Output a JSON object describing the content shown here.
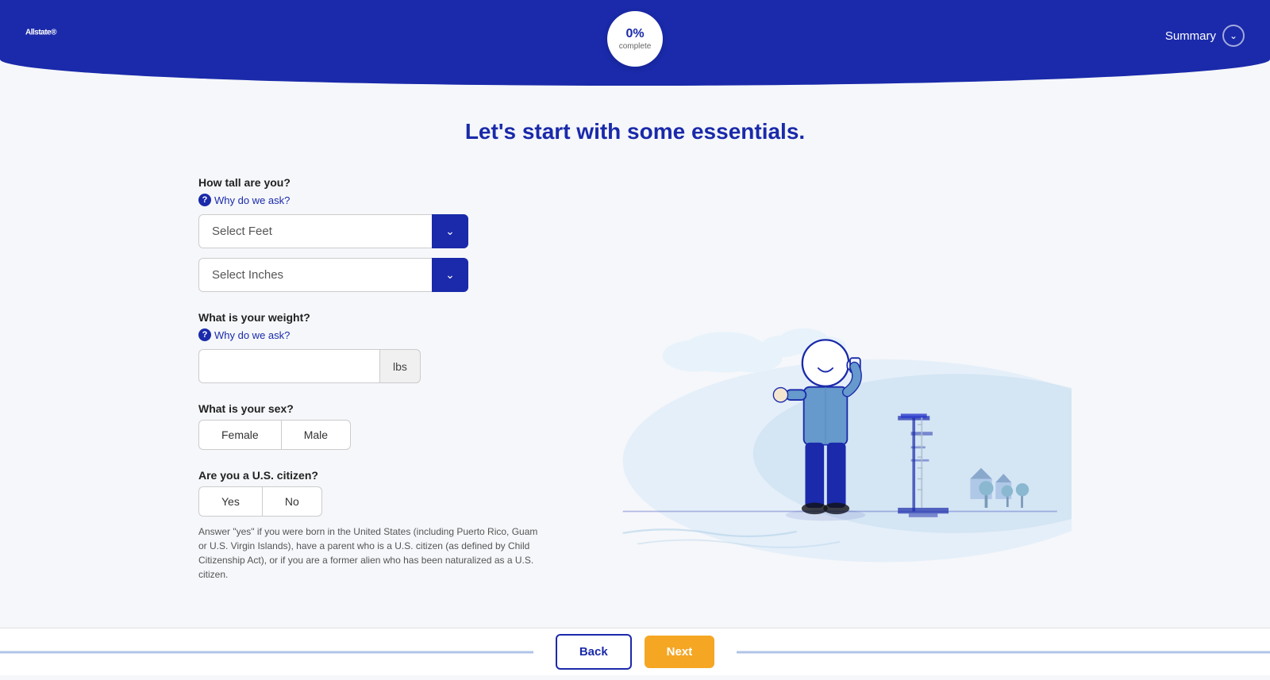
{
  "header": {
    "logo": "Allstate",
    "logo_tm": "®",
    "progress": {
      "percentage": "0%",
      "label": "complete"
    },
    "summary_button": "Summary"
  },
  "main": {
    "title": "Let's start with some essentials.",
    "fields": {
      "height": {
        "label": "How tall are you?",
        "why_ask": "Why do we ask?",
        "feet_placeholder": "Select Feet",
        "inches_placeholder": "Select Inches"
      },
      "weight": {
        "label": "What is your weight?",
        "why_ask": "Why do we ask?",
        "unit": "lbs",
        "placeholder": ""
      },
      "sex": {
        "label": "What is your sex?",
        "options": [
          "Female",
          "Male"
        ]
      },
      "citizenship": {
        "label": "Are you a U.S. citizen?",
        "options": [
          "Yes",
          "No"
        ],
        "note": "Answer \"yes\" if you were born in the United States (including Puerto Rico, Guam or U.S. Virgin Islands), have a parent who is a U.S. citizen (as defined by Child Citizenship Act), or if you are a former alien who has been naturalized as a U.S. citizen."
      }
    }
  },
  "footer": {
    "back_label": "Back",
    "next_label": "Next"
  },
  "colors": {
    "primary": "#1a2aaa",
    "accent": "#f5a623",
    "light_blue": "#d6e8f7",
    "text_dark": "#1a1a1a",
    "text_muted": "#555555"
  }
}
